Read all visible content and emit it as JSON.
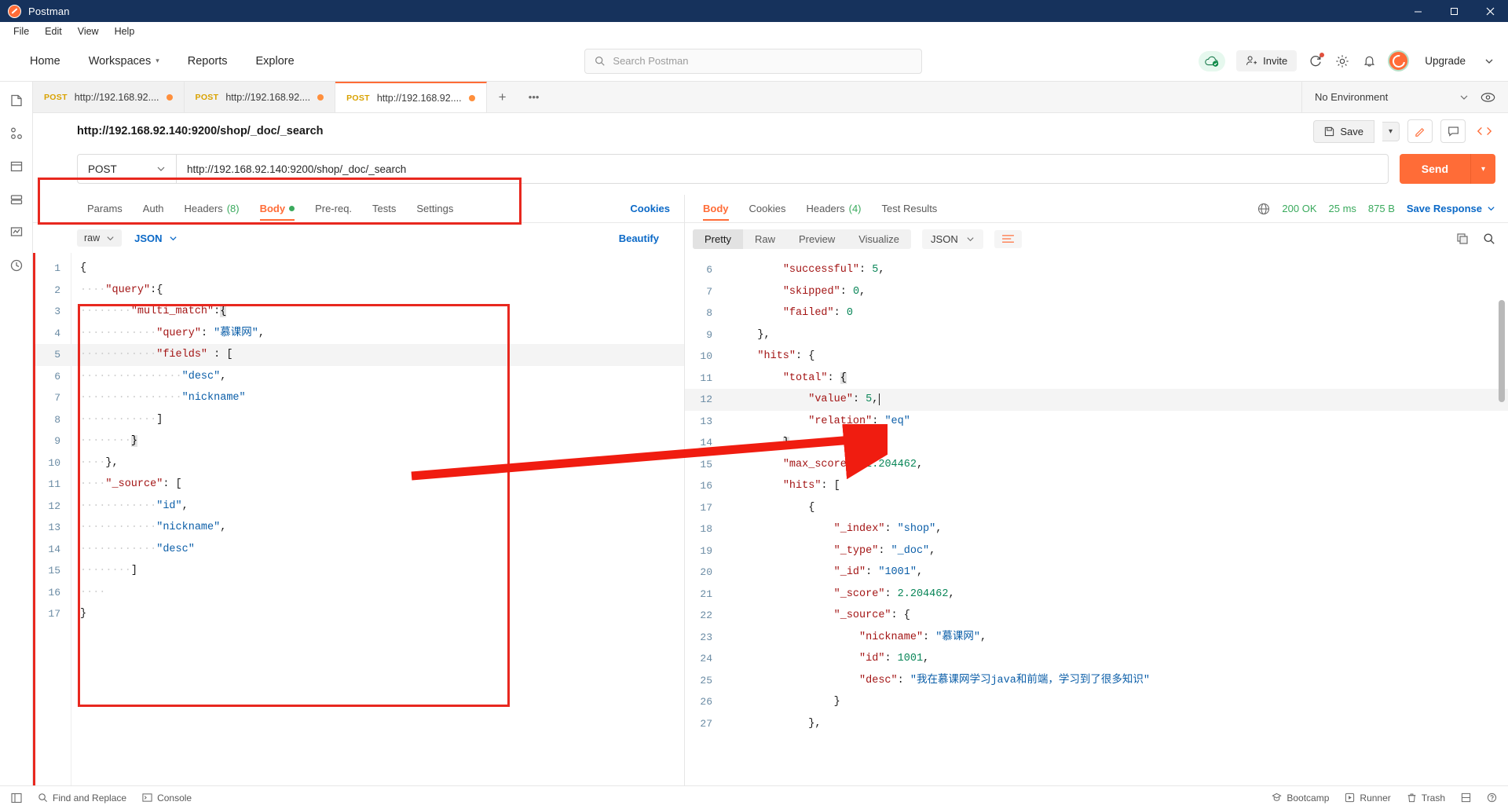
{
  "window": {
    "app_title": "Postman",
    "minimize": "—",
    "maximize": "▢",
    "close": "✕"
  },
  "menubar": {
    "items": [
      "File",
      "Edit",
      "View",
      "Help"
    ]
  },
  "header": {
    "nav": [
      {
        "label": "Home",
        "has_caret": false
      },
      {
        "label": "Workspaces",
        "has_caret": true
      },
      {
        "label": "Reports",
        "has_caret": false
      },
      {
        "label": "Explore",
        "has_caret": false
      }
    ],
    "search_placeholder": "Search Postman",
    "invite_label": "Invite",
    "upgrade_label": "Upgrade",
    "accent_color": "#ff6c37"
  },
  "tabs": {
    "items": [
      {
        "method": "POST",
        "name": "http://192.168.92....",
        "unsaved": true,
        "active": false
      },
      {
        "method": "POST",
        "name": "http://192.168.92....",
        "unsaved": true,
        "active": false
      },
      {
        "method": "POST",
        "name": "http://192.168.92....",
        "unsaved": true,
        "active": true
      }
    ],
    "new_tab": "+",
    "more": "•••",
    "environment": "No Environment"
  },
  "request": {
    "title": "http://192.168.92.140:9200/shop/_doc/_search",
    "save_label": "Save",
    "method": "POST",
    "url": "http://192.168.92.140:9200/shop/_doc/_search",
    "send_label": "Send",
    "tabs": [
      {
        "label": "Params",
        "active": false
      },
      {
        "label": "Auth",
        "active": false
      },
      {
        "label": "Headers",
        "count": "(8)",
        "active": false
      },
      {
        "label": "Body",
        "active": true,
        "dot": true
      },
      {
        "label": "Pre-req.",
        "active": false
      },
      {
        "label": "Tests",
        "active": false
      },
      {
        "label": "Settings",
        "active": false
      }
    ],
    "cookies_link": "Cookies",
    "body_mode": "raw",
    "body_format": "JSON",
    "beautify_label": "Beautify",
    "body_lines": [
      {
        "n": 1,
        "indent": 0,
        "tokens": [
          [
            "p",
            "{"
          ]
        ]
      },
      {
        "n": 2,
        "indent": 1,
        "tokens": [
          [
            "k",
            "\"query\""
          ],
          [
            "p",
            ":{"
          ]
        ]
      },
      {
        "n": 3,
        "indent": 2,
        "tokens": [
          [
            "k",
            "\"multi_match\""
          ],
          [
            "p",
            ":"
          ],
          [
            "brk",
            "{"
          ]
        ]
      },
      {
        "n": 4,
        "indent": 3,
        "tokens": [
          [
            "k",
            "\"query\""
          ],
          [
            "p",
            ": "
          ],
          [
            "s",
            "\"慕课网\""
          ],
          [
            "p",
            ","
          ]
        ]
      },
      {
        "n": 5,
        "indent": 3,
        "tokens": [
          [
            "k",
            "\"fields\""
          ],
          [
            "p",
            " : ["
          ]
        ],
        "hl": true
      },
      {
        "n": 6,
        "indent": 4,
        "tokens": [
          [
            "s",
            "\"desc\""
          ],
          [
            "p",
            ","
          ]
        ]
      },
      {
        "n": 7,
        "indent": 4,
        "tokens": [
          [
            "s",
            "\"nickname\""
          ]
        ]
      },
      {
        "n": 8,
        "indent": 3,
        "tokens": [
          [
            "p",
            "]"
          ]
        ]
      },
      {
        "n": 9,
        "indent": 2,
        "tokens": [
          [
            "brk",
            "}"
          ]
        ]
      },
      {
        "n": 10,
        "indent": 1,
        "tokens": [
          [
            "p",
            "},"
          ]
        ]
      },
      {
        "n": 11,
        "indent": 1,
        "tokens": [
          [
            "k",
            "\"_source\""
          ],
          [
            "p",
            ": ["
          ]
        ]
      },
      {
        "n": 12,
        "indent": 3,
        "tokens": [
          [
            "s",
            "\"id\""
          ],
          [
            "p",
            ","
          ]
        ]
      },
      {
        "n": 13,
        "indent": 3,
        "tokens": [
          [
            "s",
            "\"nickname\""
          ],
          [
            "p",
            ","
          ]
        ]
      },
      {
        "n": 14,
        "indent": 3,
        "tokens": [
          [
            "s",
            "\"desc\""
          ]
        ]
      },
      {
        "n": 15,
        "indent": 2,
        "tokens": [
          [
            "p",
            "]"
          ]
        ]
      },
      {
        "n": 16,
        "indent": 1,
        "tokens": []
      },
      {
        "n": 17,
        "indent": 0,
        "tokens": [
          [
            "p",
            "}"
          ]
        ]
      }
    ]
  },
  "response": {
    "tabs": [
      {
        "label": "Body",
        "active": true
      },
      {
        "label": "Cookies",
        "active": false
      },
      {
        "label": "Headers",
        "count": "(4)",
        "active": false
      },
      {
        "label": "Test Results",
        "active": false
      }
    ],
    "status": "200 OK",
    "time": "25 ms",
    "size": "875 B",
    "save_response_label": "Save Response",
    "view_modes": [
      {
        "label": "Pretty",
        "active": true
      },
      {
        "label": "Raw",
        "active": false
      },
      {
        "label": "Preview",
        "active": false
      },
      {
        "label": "Visualize",
        "active": false
      }
    ],
    "format": "JSON",
    "body_lines": [
      {
        "n": 6,
        "indent": 2,
        "clipped": true,
        "tokens": [
          [
            "k",
            "\"successful\""
          ],
          [
            "p",
            ": "
          ],
          [
            "n",
            "5"
          ],
          [
            "p",
            ","
          ]
        ]
      },
      {
        "n": 7,
        "indent": 2,
        "tokens": [
          [
            "k",
            "\"skipped\""
          ],
          [
            "p",
            ": "
          ],
          [
            "n",
            "0"
          ],
          [
            "p",
            ","
          ]
        ]
      },
      {
        "n": 8,
        "indent": 2,
        "tokens": [
          [
            "k",
            "\"failed\""
          ],
          [
            "p",
            ": "
          ],
          [
            "n",
            "0"
          ]
        ]
      },
      {
        "n": 9,
        "indent": 1,
        "tokens": [
          [
            "p",
            "},"
          ]
        ]
      },
      {
        "n": 10,
        "indent": 1,
        "tokens": [
          [
            "k",
            "\"hits\""
          ],
          [
            "p",
            ": {"
          ]
        ]
      },
      {
        "n": 11,
        "indent": 2,
        "tokens": [
          [
            "k",
            "\"total\""
          ],
          [
            "p",
            ": "
          ],
          [
            "brk",
            "{"
          ]
        ]
      },
      {
        "n": 12,
        "indent": 3,
        "tokens": [
          [
            "k",
            "\"value\""
          ],
          [
            "p",
            ": "
          ],
          [
            "n",
            "5"
          ],
          [
            "p",
            ","
          ],
          [
            "cursor",
            ""
          ]
        ],
        "hl": true
      },
      {
        "n": 13,
        "indent": 3,
        "tokens": [
          [
            "k",
            "\"relation\""
          ],
          [
            "p",
            ": "
          ],
          [
            "s",
            "\"eq\""
          ]
        ]
      },
      {
        "n": 14,
        "indent": 2,
        "tokens": [
          [
            "brk",
            "}"
          ],
          [
            "p",
            ","
          ]
        ]
      },
      {
        "n": 15,
        "indent": 2,
        "tokens": [
          [
            "k",
            "\"max_score\""
          ],
          [
            "p",
            ": "
          ],
          [
            "n",
            "2.204462"
          ],
          [
            "p",
            ","
          ]
        ]
      },
      {
        "n": 16,
        "indent": 2,
        "tokens": [
          [
            "k",
            "\"hits\""
          ],
          [
            "p",
            ": ["
          ]
        ]
      },
      {
        "n": 17,
        "indent": 3,
        "tokens": [
          [
            "p",
            "{"
          ]
        ]
      },
      {
        "n": 18,
        "indent": 4,
        "tokens": [
          [
            "k",
            "\"_index\""
          ],
          [
            "p",
            ": "
          ],
          [
            "s",
            "\"shop\""
          ],
          [
            "p",
            ","
          ]
        ]
      },
      {
        "n": 19,
        "indent": 4,
        "tokens": [
          [
            "k",
            "\"_type\""
          ],
          [
            "p",
            ": "
          ],
          [
            "s",
            "\"_doc\""
          ],
          [
            "p",
            ","
          ]
        ]
      },
      {
        "n": 20,
        "indent": 4,
        "tokens": [
          [
            "k",
            "\"_id\""
          ],
          [
            "p",
            ": "
          ],
          [
            "s",
            "\"1001\""
          ],
          [
            "p",
            ","
          ]
        ]
      },
      {
        "n": 21,
        "indent": 4,
        "tokens": [
          [
            "k",
            "\"_score\""
          ],
          [
            "p",
            ": "
          ],
          [
            "n",
            "2.204462"
          ],
          [
            "p",
            ","
          ]
        ]
      },
      {
        "n": 22,
        "indent": 4,
        "tokens": [
          [
            "k",
            "\"_source\""
          ],
          [
            "p",
            ": {"
          ]
        ]
      },
      {
        "n": 23,
        "indent": 5,
        "tokens": [
          [
            "k",
            "\"nickname\""
          ],
          [
            "p",
            ": "
          ],
          [
            "s",
            "\"慕课网\""
          ],
          [
            "p",
            ","
          ]
        ]
      },
      {
        "n": 24,
        "indent": 5,
        "tokens": [
          [
            "k",
            "\"id\""
          ],
          [
            "p",
            ": "
          ],
          [
            "n",
            "1001"
          ],
          [
            "p",
            ","
          ]
        ]
      },
      {
        "n": 25,
        "indent": 5,
        "tokens": [
          [
            "k",
            "\"desc\""
          ],
          [
            "p",
            ": "
          ],
          [
            "s",
            "\"我在慕课网学习java和前端，学习到了很多知识\""
          ]
        ]
      },
      {
        "n": 26,
        "indent": 4,
        "tokens": [
          [
            "p",
            "}"
          ]
        ]
      },
      {
        "n": 27,
        "indent": 3,
        "tokens": [
          [
            "p",
            "},"
          ]
        ]
      }
    ]
  },
  "statusbar": {
    "find_replace": "Find and Replace",
    "console": "Console",
    "bootcamp": "Bootcamp",
    "runner": "Runner",
    "trash": "Trash"
  },
  "annotation": {
    "color": "#e8281f"
  }
}
